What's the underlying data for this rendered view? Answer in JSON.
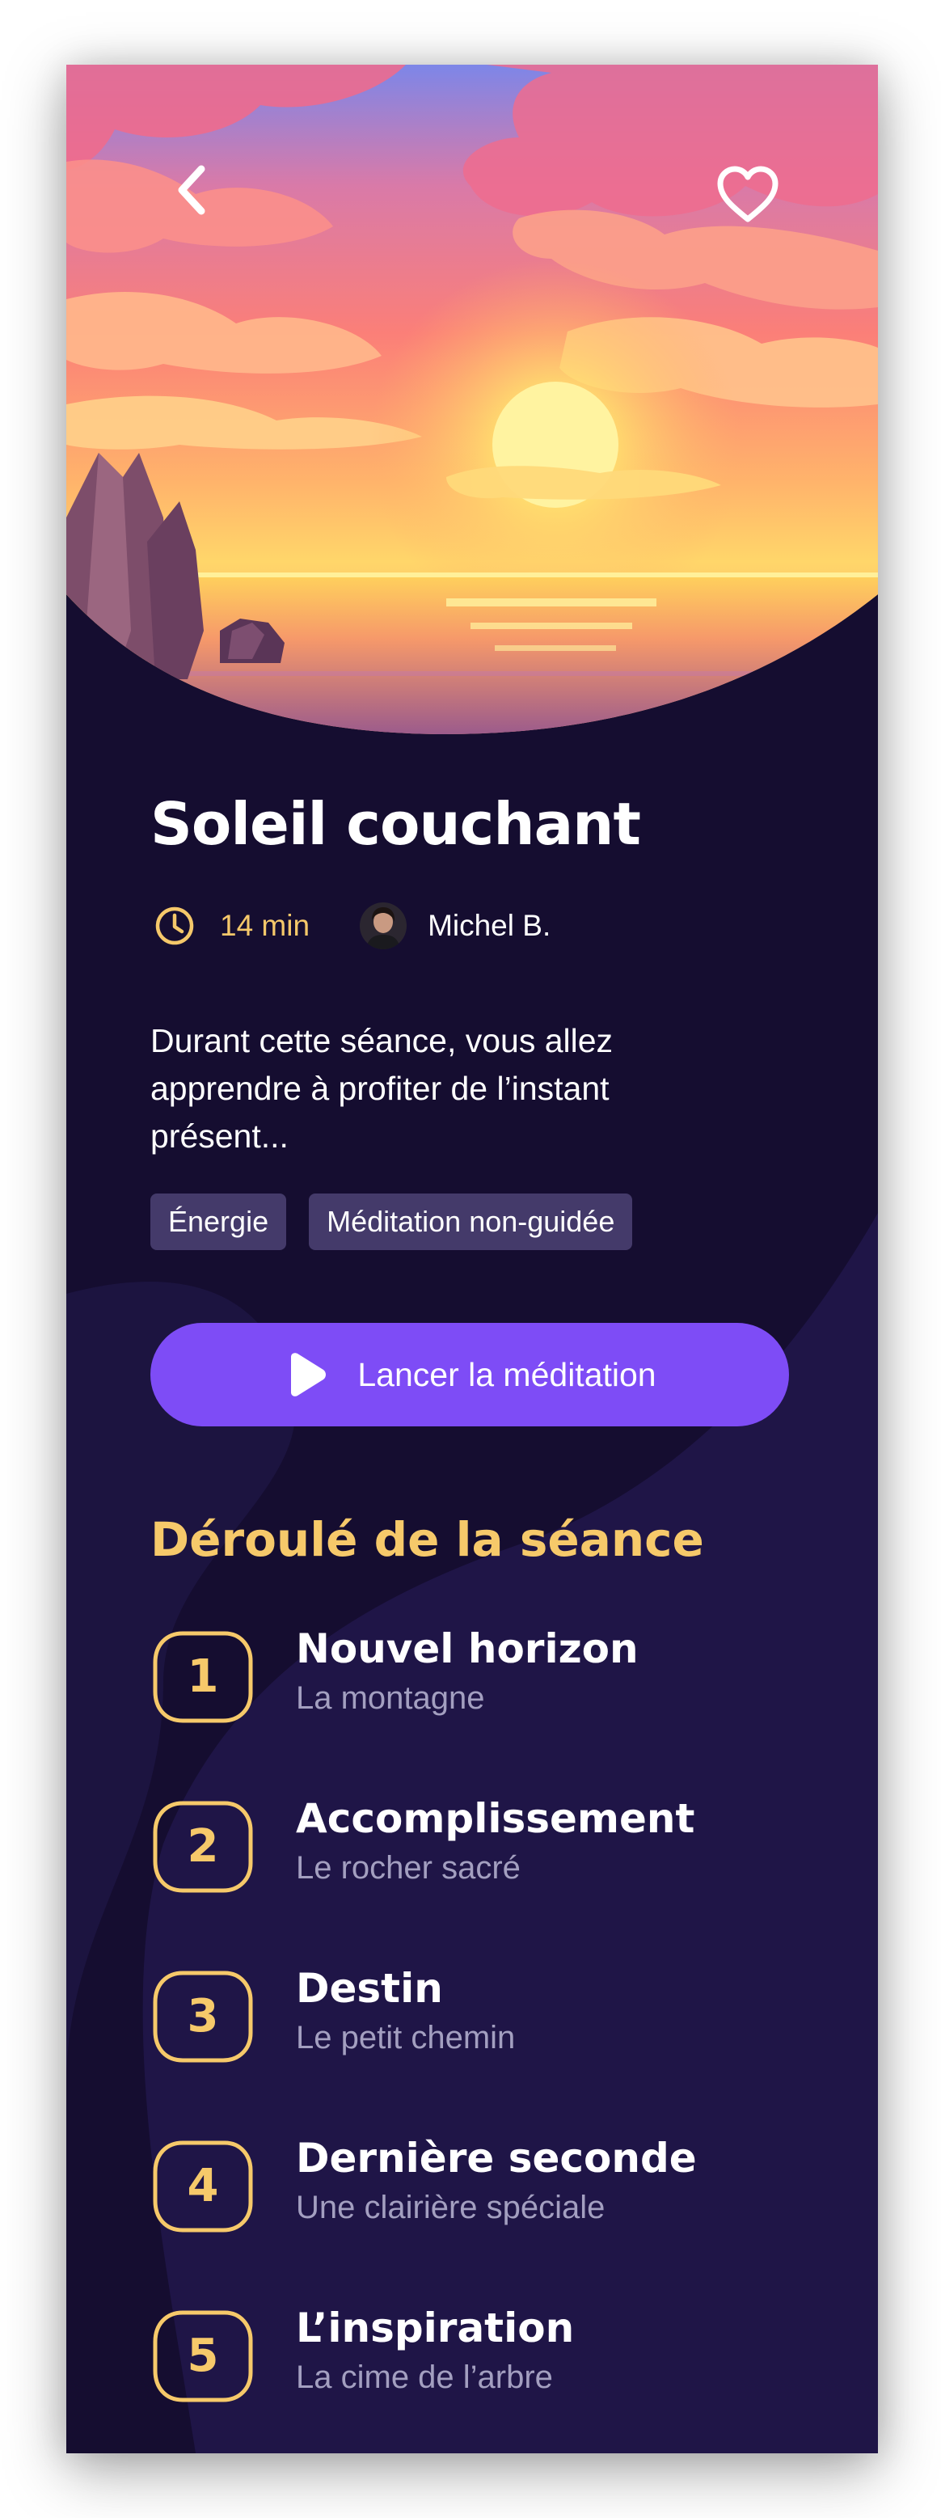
{
  "session": {
    "title": "Soleil couchant",
    "duration": "14 min",
    "author": "Michel B.",
    "description": "Durant cette séance, vous allez apprendre à profiter de l’instant présent...",
    "tags": [
      "Énergie",
      "Méditation non-guidée"
    ],
    "play_label": "Lancer la méditation"
  },
  "outline": {
    "title": "Déroulé de la séance",
    "steps": [
      {
        "number": "1",
        "title": "Nouvel horizon",
        "subtitle": "La montagne"
      },
      {
        "number": "2",
        "title": "Accomplissement",
        "subtitle": "Le rocher sacré"
      },
      {
        "number": "3",
        "title": "Destin",
        "subtitle": "Le petit chemin"
      },
      {
        "number": "4",
        "title": "Dernière seconde",
        "subtitle": "Une clairière spéciale"
      },
      {
        "number": "5",
        "title": "L’inspiration",
        "subtitle": "La cime de l’arbre"
      }
    ]
  },
  "icons": {
    "back": "chevron-left-icon",
    "favorite": "heart-icon",
    "duration": "clock-icon",
    "play": "play-icon"
  },
  "colors": {
    "background": "#150d30",
    "accent": "#7e4cf6",
    "highlight": "#f6c96a",
    "tag": "#443a6a"
  }
}
